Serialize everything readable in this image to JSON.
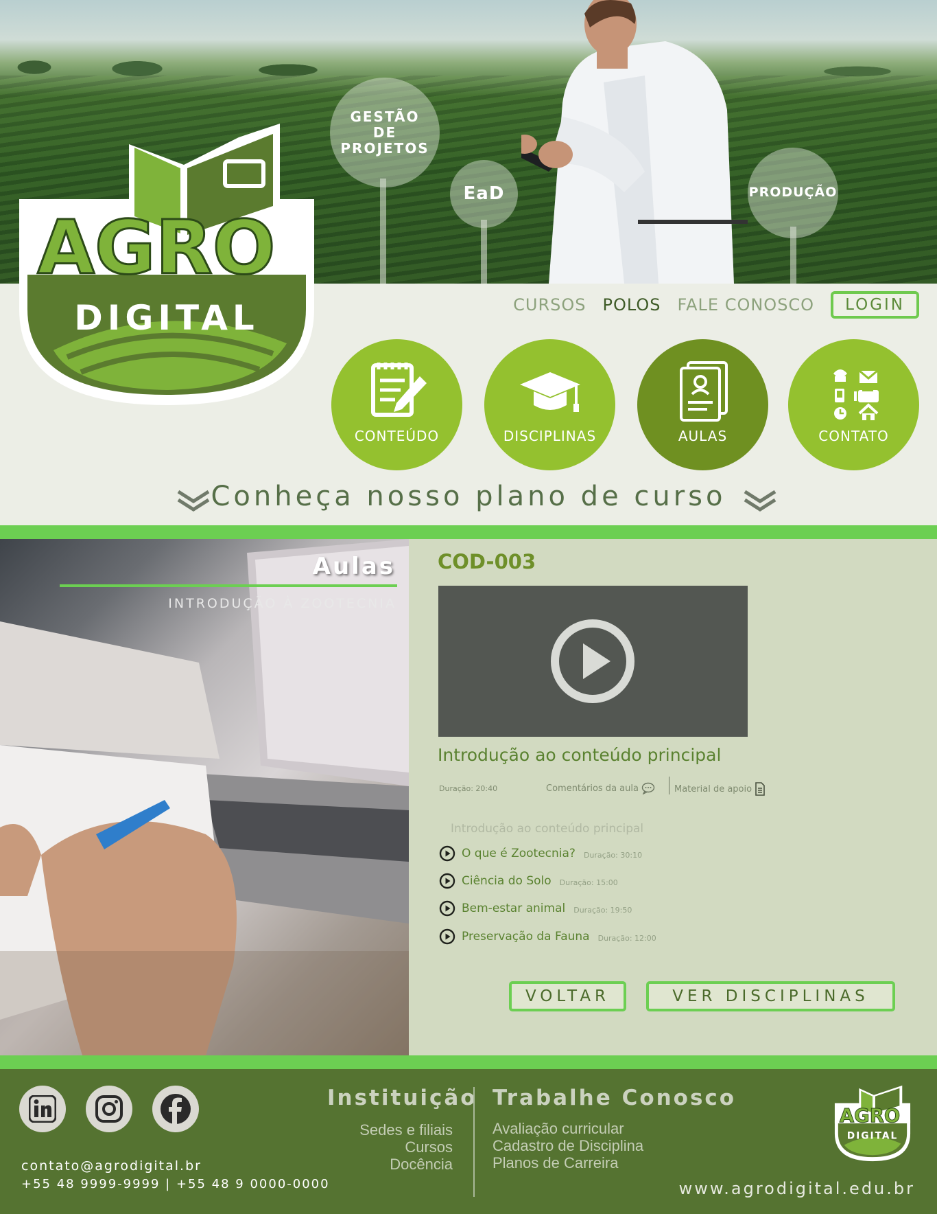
{
  "hero": {
    "bubbles": [
      "GESTÃO DE PROJETOS",
      "EaD",
      "PRODUÇÃO"
    ]
  },
  "logo": {
    "line1": "AGRO",
    "line2": "DIGITAL"
  },
  "nav": {
    "links": [
      "CURSOS",
      "POLOS",
      "FALE CONOSCO"
    ],
    "active": "POLOS",
    "login": "LOGIN"
  },
  "sections": [
    {
      "label": "CONTEÚDO",
      "icon": "notepad-pencil-icon"
    },
    {
      "label": "DISCIPLINAS",
      "icon": "graduation-cap-icon"
    },
    {
      "label": "AULAS",
      "icon": "id-document-icon"
    },
    {
      "label": "CONTATO",
      "icon": "contact-icons-grid"
    }
  ],
  "plan_heading": "Conheça nosso plano de curso",
  "course_banner": {
    "title": "Aulas",
    "subtitle": "INTRODUÇÃO À ZOOTECNIA"
  },
  "lesson": {
    "code": "COD-003",
    "title": "Introdução ao conteúdo principal",
    "duration": "Duração: 20:40",
    "comments": "Comentários da aula",
    "material": "Material de apoio",
    "list_heading": "Introdução ao conteúdo principal",
    "items": [
      {
        "name": "O que é Zootecnia?",
        "duration": "Duração: 30:10"
      },
      {
        "name": "Ciência do Solo",
        "duration": "Duração: 15:00"
      },
      {
        "name": "Bem-estar animal",
        "duration": "Duração: 19:50"
      },
      {
        "name": "Preservação da Fauna",
        "duration": "Duração: 12:00"
      }
    ],
    "back_button": "VOLTAR",
    "disciplines_button": "VER DISCIPLINAS"
  },
  "footer": {
    "social": [
      "linkedin-icon",
      "instagram-icon",
      "facebook-icon"
    ],
    "email": "contato@agrodigital.br",
    "phones": "+55 48 9999-9999 | +55 48 9 0000-0000",
    "institution": {
      "title": "Instituição",
      "links": [
        "Sedes e filiais",
        "Cursos",
        "Docência"
      ]
    },
    "careers": {
      "title": "Trabalhe Conosco",
      "links": [
        "Avaliação curricular",
        "Cadastro de Disciplina",
        "Planos de Carreira"
      ]
    },
    "url": "www.agrodigital.edu.br"
  },
  "colors": {
    "accent": "#94c12f",
    "accent_dark": "#6f9021",
    "bar": "#6ccf52",
    "footer": "#557331"
  }
}
